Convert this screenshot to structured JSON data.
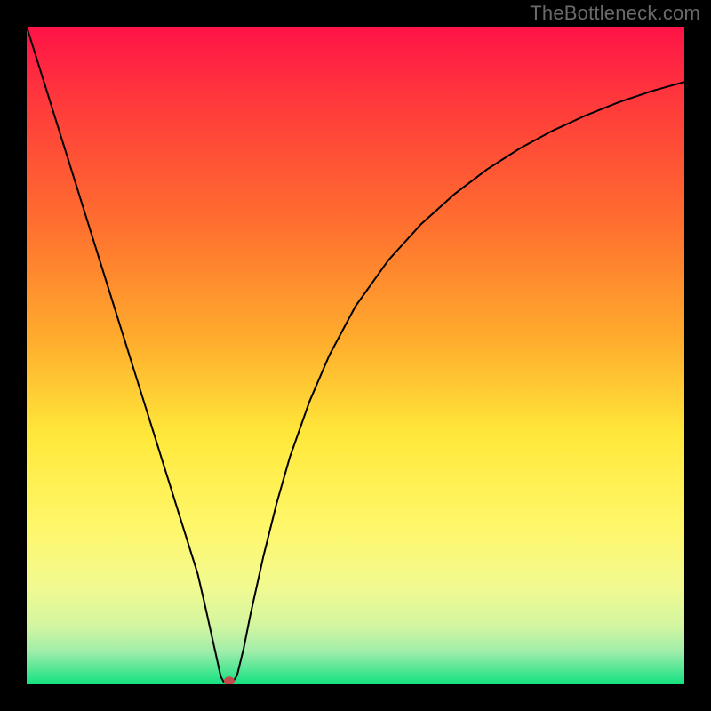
{
  "watermark": "TheBottleneck.com",
  "chart_data": {
    "type": "line",
    "title": "",
    "xlabel": "",
    "ylabel": "",
    "xlim": [
      0,
      100
    ],
    "ylim": [
      0,
      100
    ],
    "background_gradient": {
      "stops": [
        {
          "offset": 0.0,
          "color": "#ff1347"
        },
        {
          "offset": 0.12,
          "color": "#ff3b3b"
        },
        {
          "offset": 0.3,
          "color": "#ff6f2f"
        },
        {
          "offset": 0.48,
          "color": "#ffae2d"
        },
        {
          "offset": 0.62,
          "color": "#ffe83a"
        },
        {
          "offset": 0.76,
          "color": "#fff76a"
        },
        {
          "offset": 0.85,
          "color": "#f2fa90"
        },
        {
          "offset": 0.91,
          "color": "#d4f6a0"
        },
        {
          "offset": 0.95,
          "color": "#a0edaa"
        },
        {
          "offset": 0.985,
          "color": "#3de58e"
        },
        {
          "offset": 1.0,
          "color": "#15e07f"
        }
      ]
    },
    "series": [
      {
        "name": "bottleneck-curve",
        "color": "#000000",
        "width": 2,
        "x": [
          0,
          2,
          4,
          6,
          8,
          10,
          12,
          14,
          16,
          18,
          20,
          22,
          24,
          26,
          27,
          28,
          29,
          29.5,
          30,
          30.5,
          31,
          31.5,
          32,
          33,
          34,
          36,
          38,
          40,
          43,
          46,
          50,
          55,
          60,
          65,
          70,
          75,
          80,
          85,
          90,
          95,
          100
        ],
        "y": [
          100,
          93.6,
          87.2,
          80.8,
          74.4,
          68,
          61.6,
          55.2,
          48.8,
          42.4,
          36,
          29.6,
          23.2,
          16.8,
          12.5,
          8,
          3.5,
          1.2,
          0.3,
          0.3,
          0.3,
          0.6,
          1.4,
          5.5,
          10.5,
          19.5,
          27.5,
          34.5,
          43,
          50,
          57.5,
          64.5,
          70,
          74.5,
          78.3,
          81.5,
          84.2,
          86.5,
          88.5,
          90.2,
          91.6
        ]
      }
    ],
    "marker": {
      "x": 30.8,
      "y": 0.5,
      "color": "#c34a4a",
      "rx": 6,
      "ry": 5
    }
  }
}
